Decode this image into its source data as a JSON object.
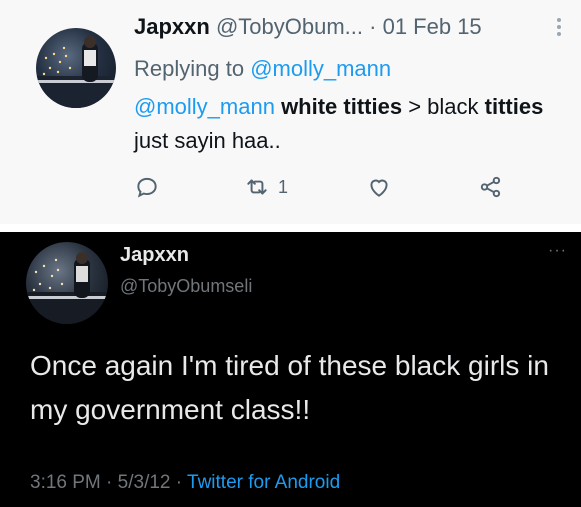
{
  "tweet_top": {
    "display_name": "Japxxn",
    "handle": "@TobyObum...",
    "separator": "·",
    "date": "01 Feb 15",
    "more_icon": "vertical-ellipsis-icon",
    "replying_prefix": "Replying to",
    "replying_to": "@molly_mann",
    "body": {
      "mention": "@molly_mann",
      "part1_bold": "white titties",
      "part2": " > black ",
      "part3_bold": "titties",
      "part4": " just sayin haa.."
    },
    "actions": {
      "reply_icon": "reply-icon",
      "retweet_icon": "retweet-icon",
      "retweet_count": "1",
      "like_icon": "heart-icon",
      "share_icon": "share-icon"
    }
  },
  "tweet_bottom": {
    "display_name": "Japxxn",
    "handle": "@TobyObumseli",
    "more": "···",
    "body": "Once again I'm tired of these black girls in my government class!!",
    "time": "3:16 PM",
    "sep1": " · ",
    "date": "5/3/12",
    "sep2": " · ",
    "source": "Twitter for Android"
  },
  "colors": {
    "link_blue": "#1d9bf0",
    "light_bg": "#f8f8f8",
    "dark_bg": "#000000"
  }
}
